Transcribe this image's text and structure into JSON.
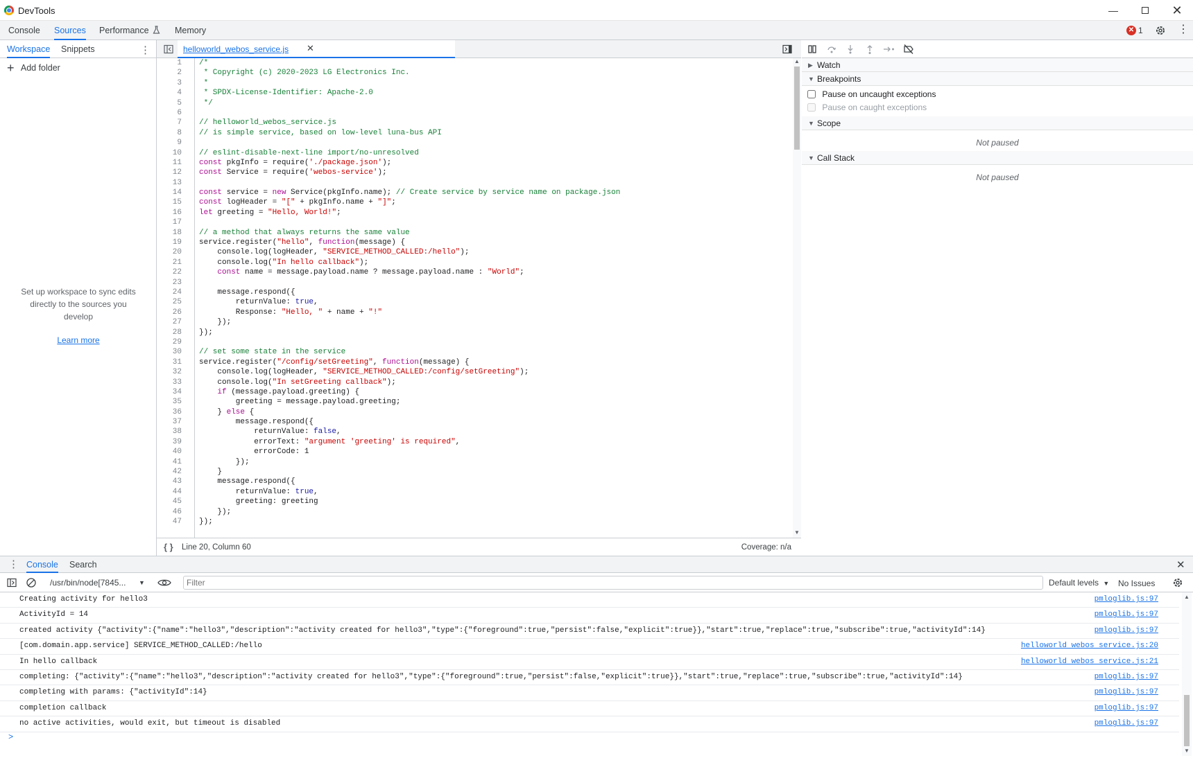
{
  "window": {
    "title": "DevTools"
  },
  "main_tabs": [
    "Console",
    "Sources",
    "Performance",
    "Memory"
  ],
  "error_count": "1",
  "navigator": {
    "tabs": [
      "Workspace",
      "Snippets"
    ],
    "add_folder": "Add folder",
    "empty_text": "Set up workspace to sync edits directly to the sources you develop",
    "learn_more": "Learn more"
  },
  "editor": {
    "file_tab": "helloworld_webos_service.js",
    "line_numbers": [
      "1",
      "2",
      "3",
      "4",
      "5",
      "6",
      "7",
      "8",
      "9",
      "10",
      "11",
      "12",
      "13",
      "14",
      "15",
      "16",
      "17",
      "18",
      "19",
      "20",
      "21",
      "22",
      "23",
      "24",
      "25",
      "26",
      "27",
      "28",
      "29",
      "30",
      "31",
      "32",
      "33",
      "34",
      "35",
      "36",
      "37",
      "38",
      "39",
      "40",
      "41",
      "42",
      "43",
      "44",
      "45",
      "46",
      "47"
    ],
    "code_lines": [
      "/*",
      " * Copyright (c) 2020-2023 LG Electronics Inc.",
      " *",
      " * SPDX-License-Identifier: Apache-2.0",
      " */",
      "",
      "// helloworld_webos_service.js",
      "// is simple service, based on low-level luna-bus API",
      "",
      "// eslint-disable-next-line import/no-unresolved",
      "const pkgInfo = require('./package.json');",
      "const Service = require('webos-service');",
      "",
      "const service = new Service(pkgInfo.name); // Create service by service name on package.json",
      "const logHeader = \"[\" + pkgInfo.name + \"]\";",
      "let greeting = \"Hello, World!\";",
      "",
      "// a method that always returns the same value",
      "service.register(\"hello\", function(message) {",
      "    console.log(logHeader, \"SERVICE_METHOD_CALLED:/hello\");",
      "    console.log(\"In hello callback\");",
      "    const name = message.payload.name ? message.payload.name : \"World\";",
      "",
      "    message.respond({",
      "        returnValue: true,",
      "        Response: \"Hello, \" + name + \"!\"",
      "    });",
      "});",
      "",
      "// set some state in the service",
      "service.register(\"/config/setGreeting\", function(message) {",
      "    console.log(logHeader, \"SERVICE_METHOD_CALLED:/config/setGreeting\");",
      "    console.log(\"In setGreeting callback\");",
      "    if (message.payload.greeting) {",
      "        greeting = message.payload.greeting;",
      "    } else {",
      "        message.respond({",
      "            returnValue: false,",
      "            errorText: \"argument 'greeting' is required\",",
      "            errorCode: 1",
      "        });",
      "    }",
      "    message.respond({",
      "        returnValue: true,",
      "        greeting: greeting",
      "    });",
      "});"
    ],
    "status_position": "Line 20, Column 60",
    "coverage": "Coverage: n/a"
  },
  "debugger": {
    "watch": "Watch",
    "breakpoints": "Breakpoints",
    "pause_uncaught": "Pause on uncaught exceptions",
    "pause_caught": "Pause on caught exceptions",
    "scope": "Scope",
    "scope_state": "Not paused",
    "call_stack": "Call Stack",
    "call_stack_state": "Not paused"
  },
  "drawer": {
    "tabs": [
      "Console",
      "Search"
    ],
    "context": "/usr/bin/node[7845...",
    "filter_placeholder": "Filter",
    "levels": "Default levels",
    "issues": "No Issues",
    "messages": [
      {
        "text": "Creating activity for hello3",
        "source": "pmloglib.js:97"
      },
      {
        "text": "ActivityId = 14",
        "source": "pmloglib.js:97"
      },
      {
        "text": "created activity {\"activity\":{\"name\":\"hello3\",\"description\":\"activity created for hello3\",\"type\":{\"foreground\":true,\"persist\":false,\"explicit\":true}},\"start\":true,\"replace\":true,\"subscribe\":true,\"activityId\":14}",
        "source": "pmloglib.js:97"
      },
      {
        "text": "[com.domain.app.service] SERVICE_METHOD_CALLED:/hello",
        "source": "helloworld webos service.js:20"
      },
      {
        "text": "In hello callback",
        "source": "helloworld webos service.js:21"
      },
      {
        "text": "completing: {\"activity\":{\"name\":\"hello3\",\"description\":\"activity created for hello3\",\"type\":{\"foreground\":true,\"persist\":false,\"explicit\":true}},\"start\":true,\"replace\":true,\"subscribe\":true,\"activityId\":14}",
        "source": "pmloglib.js:97"
      },
      {
        "text": "completing with params: {\"activityId\":14}",
        "source": "pmloglib.js:97"
      },
      {
        "text": "completion callback",
        "source": "pmloglib.js:97"
      },
      {
        "text": "no active activities, would exit, but timeout is disabled",
        "source": "pmloglib.js:97"
      }
    ],
    "prompt": ">"
  },
  "colors": {
    "accent": "#1a73e8",
    "error": "#d93025"
  }
}
